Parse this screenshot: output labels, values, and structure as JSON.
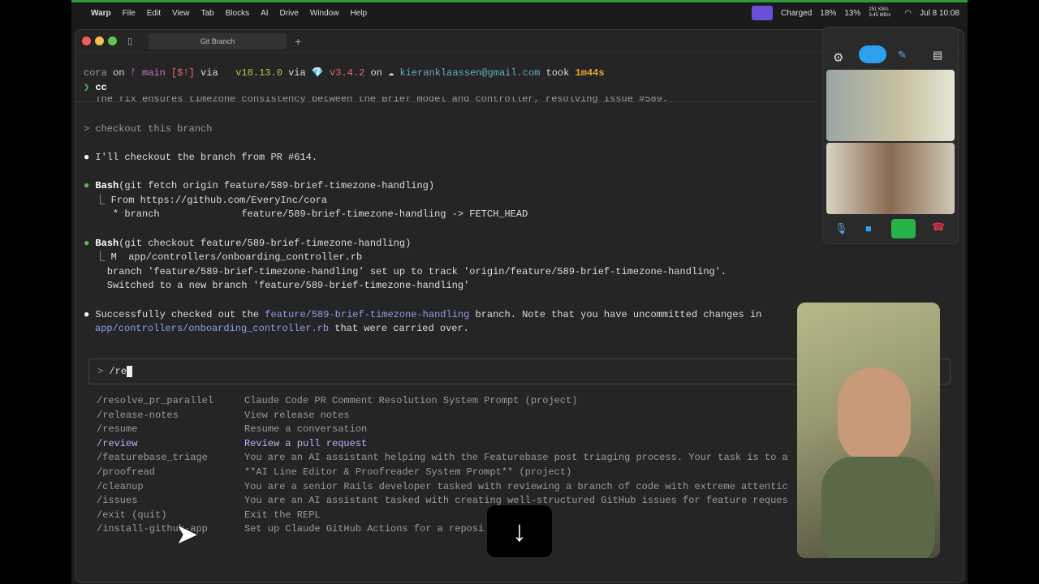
{
  "menubar": {
    "apple": "",
    "app": "Warp",
    "items": [
      "File",
      "Edit",
      "View",
      "Tab",
      "Blocks",
      "AI",
      "Drive",
      "Window",
      "Help"
    ],
    "battery": "Charged",
    "cpu": "18%",
    "mem": "13%",
    "net": "251 KB/s 3.45 MB/s",
    "clock": "Jul 8 10:08"
  },
  "window": {
    "tab_title": "Git Branch",
    "new_tab": "+"
  },
  "prompt": {
    "dir": "cora",
    "on": " on ",
    "branch": "ᚠ main",
    "status": " [$!]",
    "via": " via ",
    "node": "v18.13.0",
    "via2": " via ",
    "ruby_icon": "💎",
    "ruby": " v3.4.2",
    "on2": " on ",
    "cloud": "☁",
    "email": " kieranklaassen@gmail.com",
    "took": " took ",
    "duration": "1m44s",
    "cmd_sym": "❯",
    "cmd": "cc"
  },
  "transcript": {
    "cut_line": "  The fix ensures timezone consistency between the Brief model and controller, resolving issue #589.",
    "user_msg": "> checkout this branch",
    "msg1": "I'll checkout the branch from PR #614.",
    "bash1_tool": "Bash",
    "bash1_args": "(git fetch origin feature/589-brief-timezone-handling)",
    "bash1_out1": "  ⎿ From https://github.com/EveryInc/cora",
    "bash1_out2": "     * branch              feature/589-brief-timezone-handling -> FETCH_HEAD",
    "bash2_tool": "Bash",
    "bash2_args": "(git checkout feature/589-brief-timezone-handling)",
    "bash2_out1": "  ⎿ M  app/controllers/onboarding_controller.rb",
    "bash2_out2": "    branch 'feature/589-brief-timezone-handling' set up to track 'origin/feature/589-brief-timezone-handling'.",
    "bash2_out3": "    Switched to a new branch 'feature/589-brief-timezone-handling'",
    "success_a": "Successfully checked out the ",
    "success_branch": "feature/589-brief-timezone-handling",
    "success_b": " branch. Note that you have uncommitted changes in",
    "success_path": "app/controllers/onboarding_controller.rb",
    "success_c": " that were carried over."
  },
  "input": {
    "prefix": ">",
    "value": "/re"
  },
  "commands": [
    {
      "name": "/resolve_pr_parallel",
      "desc": "Claude Code PR Comment Resolution System Prompt (project)"
    },
    {
      "name": "/release-notes",
      "desc": "View release notes"
    },
    {
      "name": "/resume",
      "desc": "Resume a conversation"
    },
    {
      "name": "/review",
      "desc": "Review a pull request",
      "selected": true
    },
    {
      "name": "/featurebase_triage",
      "desc": "You are an AI assistant helping with the Featurebase post triaging process. Your task is to a"
    },
    {
      "name": "/proofread",
      "desc": "**AI Line Editor & Proofreader System Prompt** (project)"
    },
    {
      "name": "/cleanup",
      "desc": "You are a senior Rails developer tasked with reviewing a branch of code with extreme attentic"
    },
    {
      "name": "/issues",
      "desc": "You are an AI assistant tasked with creating well-structured GitHub issues for feature reques"
    },
    {
      "name": "/exit (quit)",
      "desc": "Exit the REPL"
    },
    {
      "name": "/install-github-app",
      "desc": "Set up Claude GitHub Actions for a reposi"
    }
  ],
  "scroll_button": "↓",
  "colors": {
    "accent": "#6b4fd8",
    "bullet": "#5fb85f",
    "selected": "#b8b4ff",
    "path": "#8e9ee8"
  }
}
